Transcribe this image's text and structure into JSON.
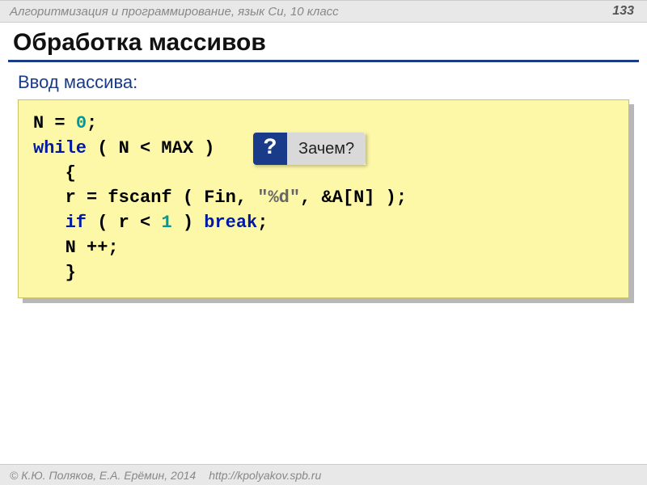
{
  "header": {
    "course": "Алгоритмизация и программирование, язык Си, 10 класс",
    "page": "133"
  },
  "title": "Обработка массивов",
  "subtitle": "Ввод массива:",
  "code": {
    "l1a": "N = ",
    "l1num": "0",
    "l1b": ";",
    "l2a": "while",
    "l2b": " ( N < MAX )",
    "l3": "   {",
    "l4a": "   r = fscanf ( Fin, ",
    "l4str": "\"%d\"",
    "l4b": ", &A[N] );",
    "l5a": "   ",
    "l5if": "if",
    "l5b": " ( r < ",
    "l5num": "1",
    "l5c": " ) ",
    "l5brk": "break",
    "l5d": ";",
    "l6": "   N ++;",
    "l7": "   }"
  },
  "callout": {
    "mark": "?",
    "label": "Зачем?"
  },
  "footer": {
    "copyright": "© К.Ю. Поляков, Е.А. Ерёмин, 2014",
    "url": "http://kpolyakov.spb.ru"
  }
}
